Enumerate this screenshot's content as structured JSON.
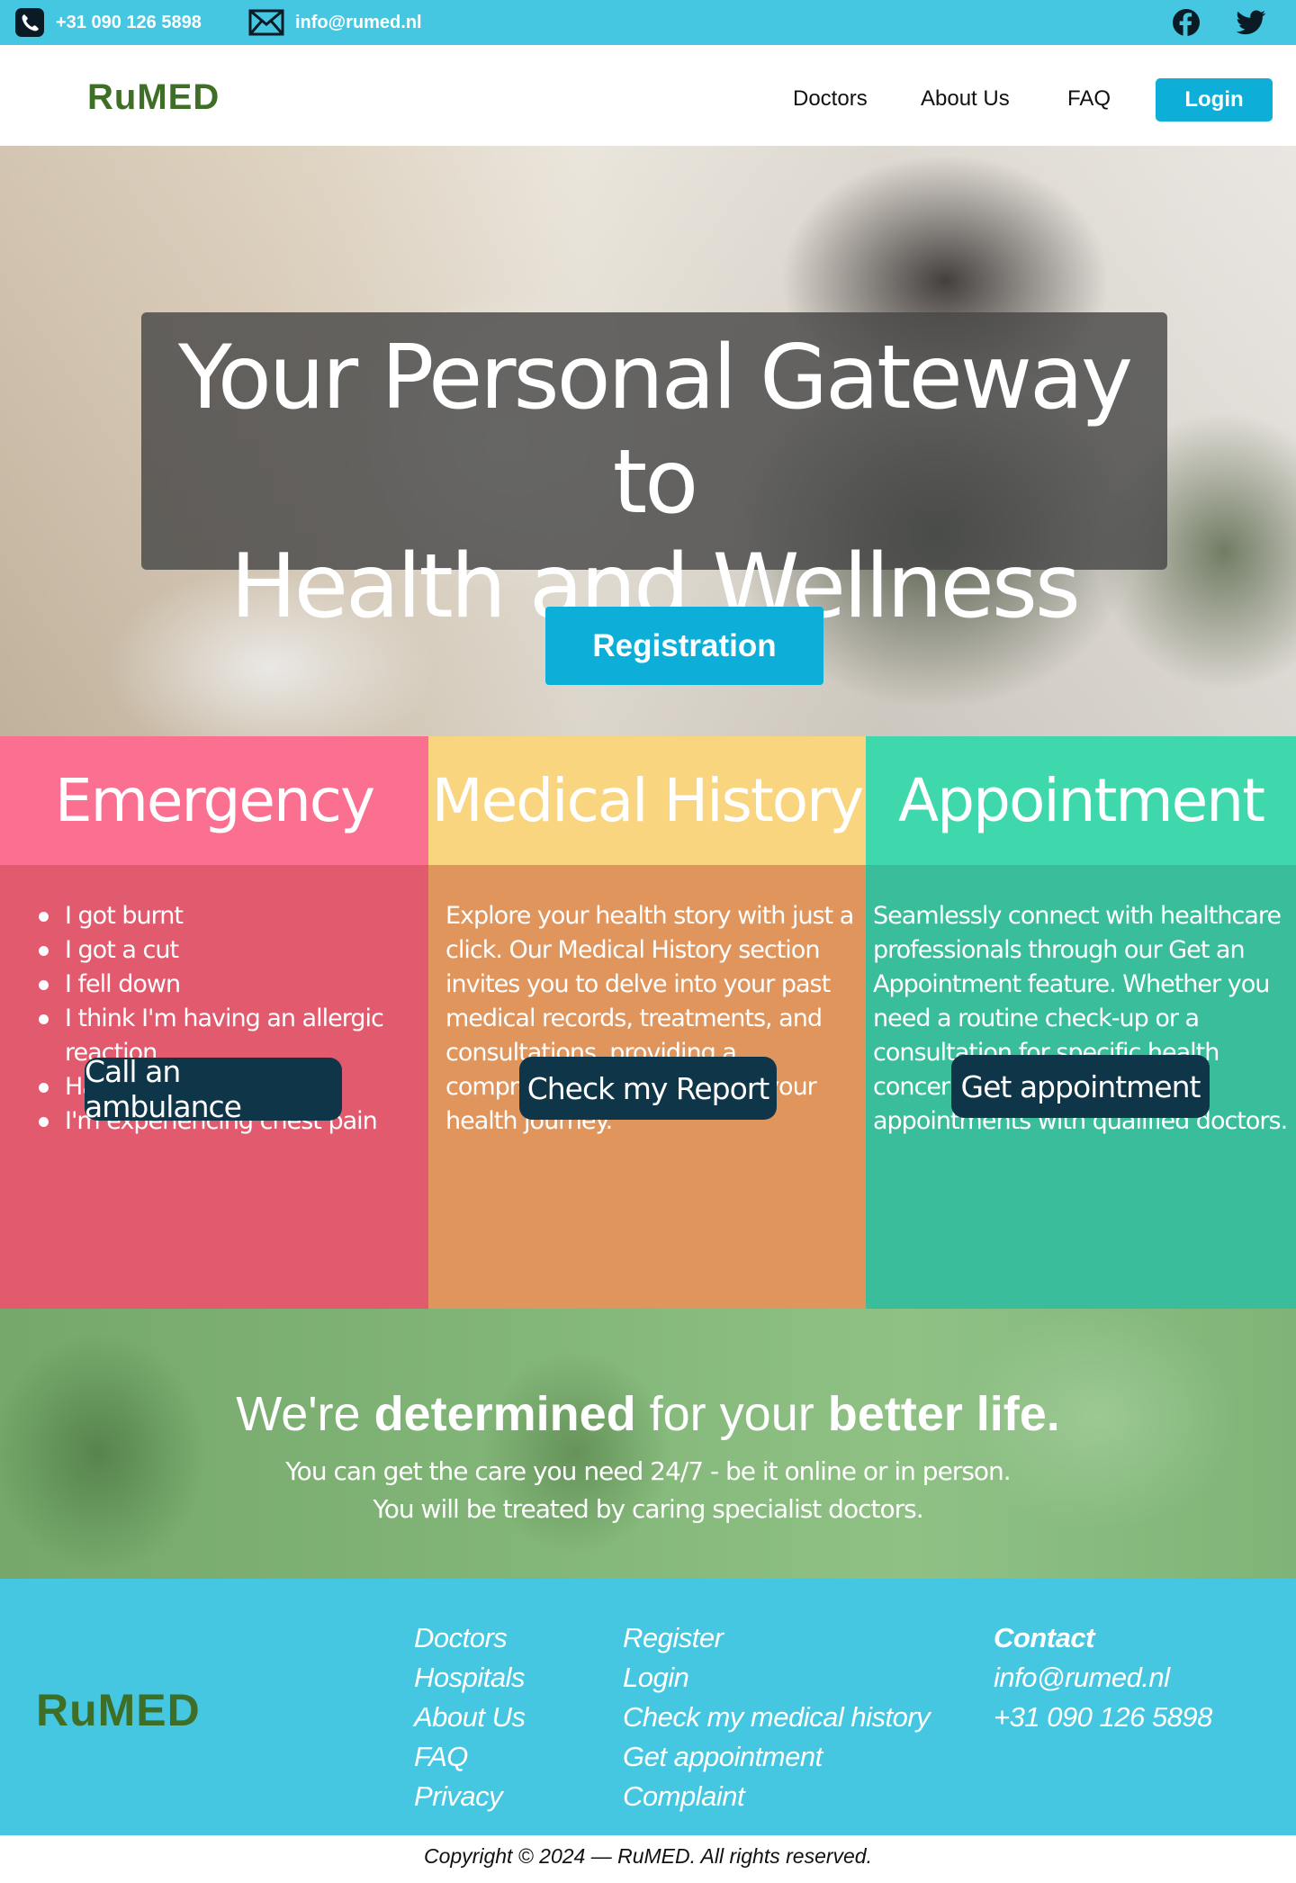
{
  "topbar": {
    "phone": "+31 090 126 5898",
    "email": "info@rumed.nl",
    "phone_icon": "phone-icon",
    "email_icon": "envelope-icon",
    "facebook_icon": "facebook-icon",
    "twitter_icon": "twitter-icon"
  },
  "nav": {
    "brand": "RuMED",
    "links": [
      "Doctors",
      "About Us",
      "FAQ"
    ],
    "login": "Login"
  },
  "hero": {
    "title_line1": "Your Personal Gateway to",
    "title_line2": "Health and Wellness",
    "registration": "Registration"
  },
  "cards": {
    "emergency": {
      "title": "Emergency",
      "items": [
        "I got burnt",
        "I got a cut",
        "I fell down",
        "I think I'm having an allergic reaction",
        "Have a High Feveraction",
        "I'm experiencing chest pain"
      ],
      "button": "Call an ambulance"
    },
    "history": {
      "title": "Medical History",
      "text": "Explore your health story with just a click. Our Medical History section invites you to delve into your past medical records, treatments, and consultations, providing a comprehensive overview of your health journey.",
      "button": "Check my Report"
    },
    "appointment": {
      "title": "Appointment",
      "text": "Seamlessly connect with healthcare professionals through our Get an Appointment feature. Whether you need a routine check-up or a consultation for specific health concerns, easily schedule appointments with qualified doctors.",
      "button": "Get appointment"
    }
  },
  "band": {
    "headline_part1": "We're ",
    "headline_bold1": "determined",
    "headline_part2": " for your ",
    "headline_bold2": "better life.",
    "sub1": "You can get the care you need 24/7 - be it online or in person.",
    "sub2": "You will be treated by caring specialist doctors."
  },
  "footer": {
    "brand": "RuMED",
    "col1": [
      "Doctors",
      "Hospitals",
      "About Us",
      "FAQ",
      "Privacy"
    ],
    "col2": [
      "Register",
      "Login",
      "Check my medical history",
      "Get appointment",
      "Complaint"
    ],
    "contact_title": "Contact",
    "contact_email": "info@rumed.nl",
    "contact_phone": "+31 090 126 5898",
    "copyright": "Copyright © 2024 — RuMED. All rights reserved."
  },
  "colors": {
    "accent_blue": "#45c7e2",
    "button_blue": "#0daed8",
    "brand_green": "#3f6f27",
    "emergency_head": "#fb7090",
    "history_head": "#f9d57f",
    "appointment_head": "#3fd8ad",
    "dark_button": "#0f3548"
  }
}
